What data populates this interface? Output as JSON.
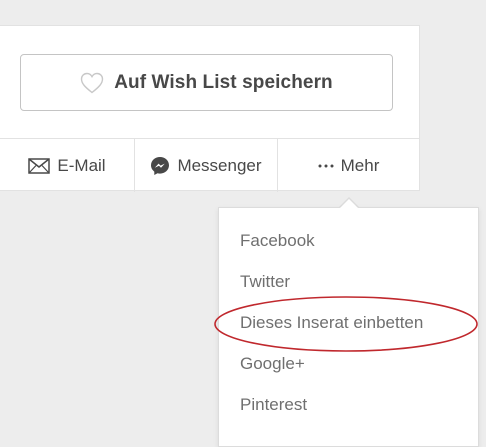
{
  "wishlist": {
    "button_label": "Auf Wish List speichern",
    "icon": "heart-outline-icon"
  },
  "share": {
    "items": [
      {
        "label": "E-Mail",
        "icon": "envelope-icon"
      },
      {
        "label": "Messenger",
        "icon": "messenger-icon"
      },
      {
        "label": "Mehr",
        "icon": "ellipsis-icon"
      }
    ]
  },
  "more_menu": {
    "items": [
      {
        "label": "Facebook"
      },
      {
        "label": "Twitter"
      },
      {
        "label": "Dieses Inserat einbetten",
        "highlighted": true
      },
      {
        "label": "Google+"
      },
      {
        "label": "Pinterest"
      }
    ]
  },
  "colors": {
    "page_background": "#ededed",
    "text_primary": "#484848",
    "text_menu": "#6f6f6f",
    "highlight_ring": "#c0282d"
  }
}
